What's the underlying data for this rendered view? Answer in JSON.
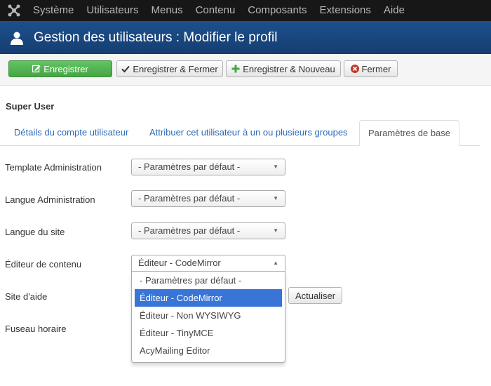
{
  "topbar": {
    "logo_icon": "joomla-logo-icon",
    "menu": [
      "Système",
      "Utilisateurs",
      "Menus",
      "Contenu",
      "Composants",
      "Extensions",
      "Aide"
    ]
  },
  "titlebar": {
    "icon": "user-icon",
    "title": "Gestion des utilisateurs : Modifier le profil"
  },
  "toolbar": {
    "save_label": "Enregistrer",
    "save_close_label": "Enregistrer & Fermer",
    "save_new_label": "Enregistrer & Nouveau",
    "close_label": "Fermer",
    "colors": {
      "success": "#46a546",
      "close_icon": "#c0392b",
      "new_icon": "#46a546"
    }
  },
  "section_title": "Super User",
  "tabs": [
    "Détails du compte utilisateur",
    "Attribuer cet utilisateur à un ou plusieurs groupes",
    "Paramètres de base"
  ],
  "form": {
    "admin_template_label": "Template Administration",
    "admin_template_value": "- Paramètres par défaut -",
    "admin_language_label": "Langue Administration",
    "admin_language_value": "- Paramètres par défaut -",
    "site_language_label": "Langue du site",
    "site_language_value": "- Paramètres par défaut -",
    "editor_label": "Éditeur de contenu",
    "editor_value": "Éditeur - CodeMirror",
    "editor_options": [
      "- Paramètres par défaut -",
      "Éditeur - CodeMirror",
      "Éditeur - Non WYSIWYG",
      "Éditeur - TinyMCE",
      "AcyMailing Editor"
    ],
    "help_site_label": "Site d'aide",
    "update_label": "Actualiser",
    "timezone_label": "Fuseau horaire"
  }
}
